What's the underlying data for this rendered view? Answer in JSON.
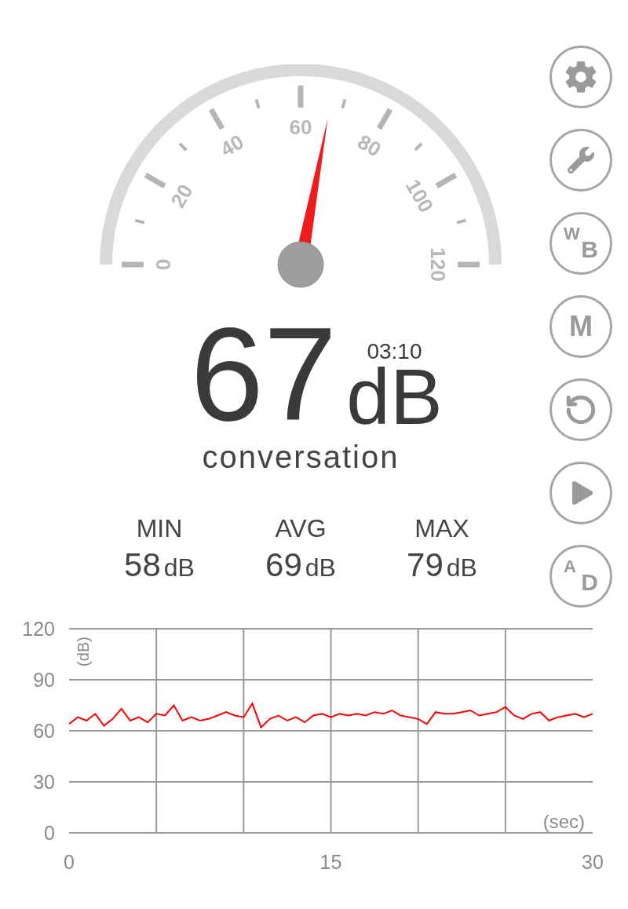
{
  "gauge": {
    "labels": [
      "0",
      "20",
      "40",
      "60",
      "80",
      "100",
      "120"
    ]
  },
  "reading": {
    "value": "67",
    "unit": "dB",
    "time": "03:10",
    "description": "conversation"
  },
  "stats": [
    {
      "label": "MIN",
      "value": "58",
      "unit": "dB"
    },
    {
      "label": "AVG",
      "value": "69",
      "unit": "dB"
    },
    {
      "label": "MAX",
      "value": "79",
      "unit": "dB"
    }
  ],
  "buttons": [
    {
      "kind": "settings"
    },
    {
      "kind": "wrench"
    },
    {
      "kind": "pair",
      "top": "W",
      "bottom": "B"
    },
    {
      "kind": "text",
      "label": "M"
    },
    {
      "kind": "reset"
    },
    {
      "kind": "play"
    },
    {
      "kind": "pair",
      "top": "A",
      "bottom": "D"
    }
  ],
  "chart": {
    "chart_data": {
      "type": "line",
      "xlabel": "(sec)",
      "ylabel": "(dB)",
      "x": [
        0,
        0.5,
        1,
        1.5,
        2,
        2.5,
        3,
        3.5,
        4,
        4.5,
        5,
        5.5,
        6,
        6.5,
        7,
        7.5,
        8,
        8.5,
        9,
        9.5,
        10,
        10.5,
        11,
        11.5,
        12,
        12.5,
        13,
        13.5,
        14,
        14.5,
        15,
        15.5,
        16,
        16.5,
        17,
        17.5,
        18,
        18.5,
        19,
        19.5,
        20,
        20.5,
        21,
        21.5,
        22,
        22.5,
        23,
        23.5,
        24,
        24.5,
        25,
        25.5,
        26,
        26.5,
        27,
        27.5,
        28,
        28.5,
        29,
        29.5,
        30
      ],
      "series": [
        {
          "color": "#ff0000",
          "values": [
            64,
            68,
            66,
            70,
            63,
            67,
            73,
            66,
            68,
            65,
            70,
            69,
            75,
            66,
            68,
            66,
            67,
            69,
            71,
            69,
            68,
            76,
            62,
            67,
            69,
            66,
            68,
            65,
            69,
            70,
            68,
            70,
            69,
            70,
            69,
            71,
            70,
            72,
            69,
            68,
            67,
            64,
            71,
            70,
            70,
            71,
            72,
            69,
            70,
            71,
            74,
            69,
            67,
            70,
            71,
            66,
            68,
            69,
            70,
            68,
            70
          ]
        }
      ],
      "grid": true,
      "xlim": [
        0,
        30
      ],
      "ylim": [
        0,
        120
      ],
      "xticks": [
        0,
        15,
        30
      ],
      "yticks": [
        0,
        30,
        60,
        90,
        120
      ]
    }
  }
}
